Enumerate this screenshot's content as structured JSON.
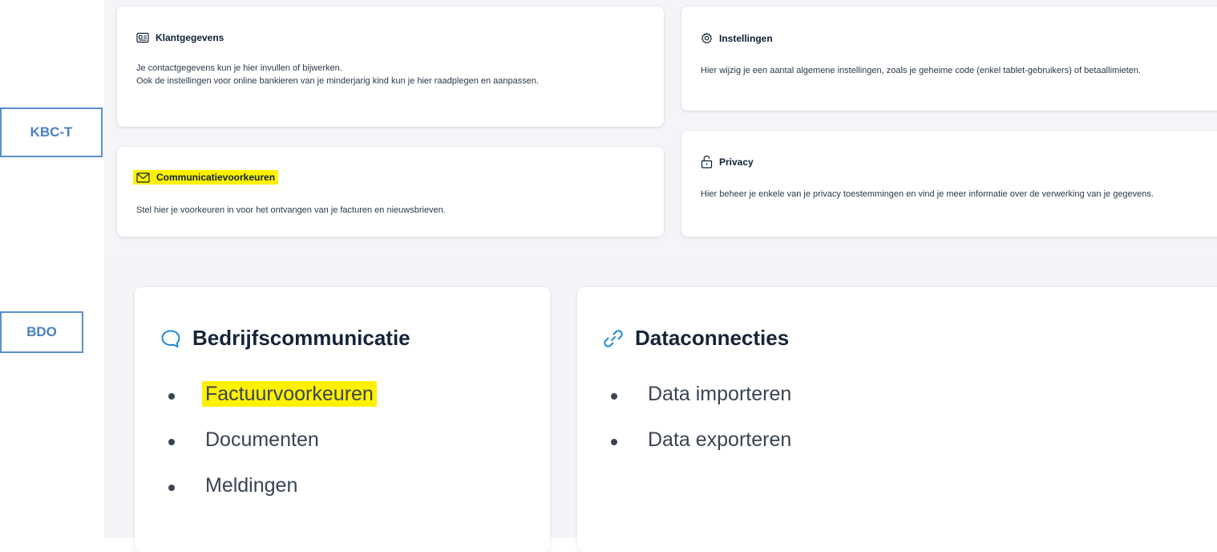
{
  "labels": {
    "kbc": "KBC-T",
    "bdo": "BDO"
  },
  "kbc": {
    "klantgegevens": {
      "title": "Klantgegevens",
      "desc1": "Je contactgegevens kun je hier invullen of bijwerken.",
      "desc2": "Ook de instellingen voor online bankieren van je minderjarig kind kun je hier raadplegen en aanpassen."
    },
    "instellingen": {
      "title": "Instellingen",
      "desc": "Hier wijzig je een aantal algemene instellingen, zoals je geheime code (enkel tablet-gebruikers) of betaallimieten."
    },
    "communicatie": {
      "title": "Communicatievoorkeuren",
      "desc": "Stel hier je voorkeuren in voor het ontvangen van je facturen en nieuwsbrieven."
    },
    "privacy": {
      "title": "Privacy",
      "desc": "Hier beheer je enkele van je privacy toestemmingen en vind je meer informatie over de verwerking van je gegevens."
    }
  },
  "bdo": {
    "bedrijf": {
      "title": "Bedrijfscommunicatie",
      "items": [
        "Factuurvoorkeuren",
        "Documenten",
        "Meldingen"
      ]
    },
    "data": {
      "title": "Dataconnecties",
      "items": [
        "Data importeren",
        "Data exporteren"
      ]
    }
  },
  "colors": {
    "highlight": "#fff100",
    "accent": "#1f8ad6",
    "label": "#4a7fc5"
  },
  "icons": {
    "klantgegevens": "id-card-icon",
    "instellingen": "gear-icon",
    "communicatie": "envelope-icon",
    "privacy": "lock-icon",
    "bedrijf": "chat-bubble-icon",
    "data": "link-icon"
  }
}
